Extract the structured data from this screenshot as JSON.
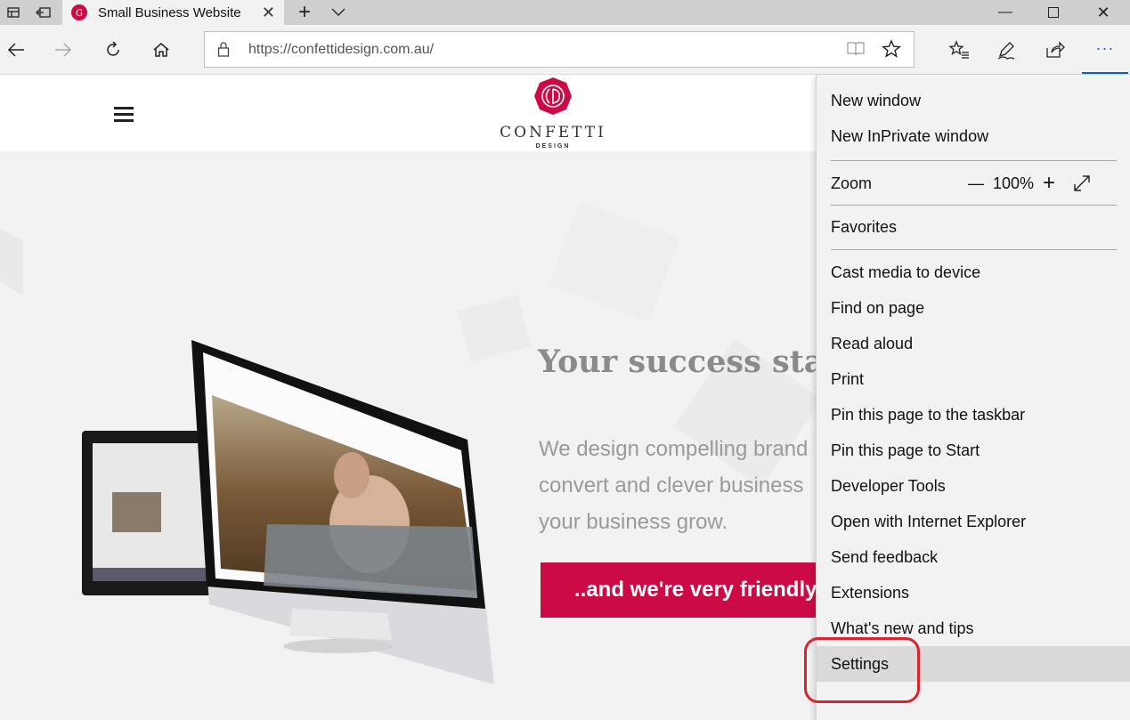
{
  "browser": {
    "tab": {
      "title": "Small Business Website",
      "close_glyph": "✕"
    },
    "new_tab_glyph": "+",
    "tab_list_glyph": "⌄",
    "window_controls": {
      "minimize": "—",
      "maximize": "☐",
      "close": "✕"
    },
    "address": {
      "url": "https://confettidesign.com.au/"
    },
    "more_glyph": "···"
  },
  "site": {
    "logo_word": "CONFETTI",
    "logo_sub": "DESIGN",
    "hero_title": "Your success star",
    "hero_lines": [
      "We design compelling brand",
      "convert and clever business",
      "your business grow."
    ],
    "cta": "..and we're very friendly - "
  },
  "menu": {
    "items": [
      "New window",
      "New InPrivate window",
      "Zoom",
      "Favorites",
      "Cast media to device",
      "Find on page",
      "Read aloud",
      "Print",
      "Pin this page to the taskbar",
      "Pin this page to Start",
      "Developer Tools",
      "Open with Internet Explorer",
      "Send feedback",
      "Extensions",
      "What's new and tips",
      "Settings"
    ],
    "zoom": {
      "minus": "—",
      "value": "100%",
      "plus": "+"
    },
    "selected": "Settings"
  },
  "colors": {
    "accent": "#0a64c8",
    "brand": "#cc0a45",
    "highlight": "#d9232d"
  }
}
